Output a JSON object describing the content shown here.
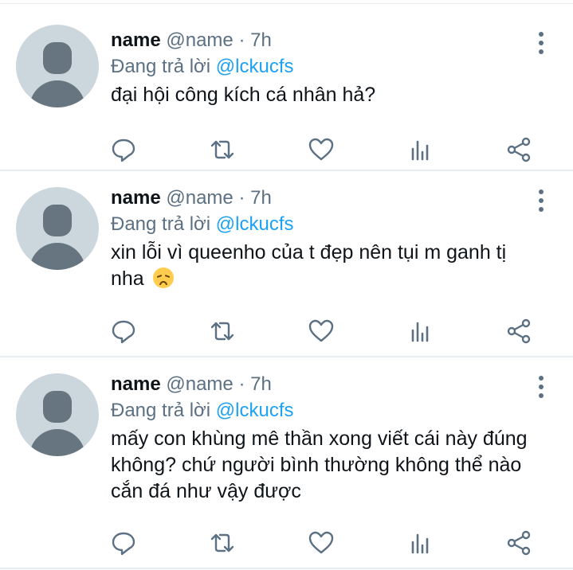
{
  "tweets": [
    {
      "name": "name",
      "handle": "@name",
      "separator": "·",
      "time": "7h",
      "reply_prefix": "Đang trả lời",
      "reply_to": "@lckucfs",
      "text": "đại hội công kích cá nhân hả?"
    },
    {
      "name": "name",
      "handle": "@name",
      "separator": "·",
      "time": "7h",
      "reply_prefix": "Đang trả lời",
      "reply_to": "@lckucfs",
      "text": "xin lỗi vì queenho của t đẹp nên tụi m ganh tị nha",
      "emoji": "disappointed-face-icon"
    },
    {
      "name": "name",
      "handle": "@name",
      "separator": "·",
      "time": "7h",
      "reply_prefix": "Đang trả lời",
      "reply_to": "@lckucfs",
      "text": "mấy con khùng mê thần xong viết cái này đúng không? chứ người bình thường không thể nào cắn đá như vậy được"
    }
  ],
  "icons": {
    "reply": "comment-icon",
    "retweet": "retweet-icon",
    "like": "heart-icon",
    "analytics": "analytics-icon",
    "share": "share-icon",
    "more": "more-vertical-icon"
  },
  "colors": {
    "text": "#0f1419",
    "secondary": "#5b7083",
    "mention": "#1da1f2",
    "divider": "#e6ecf0",
    "avatar_bg": "#ccd6dd",
    "avatar_fg": "#66757f"
  }
}
